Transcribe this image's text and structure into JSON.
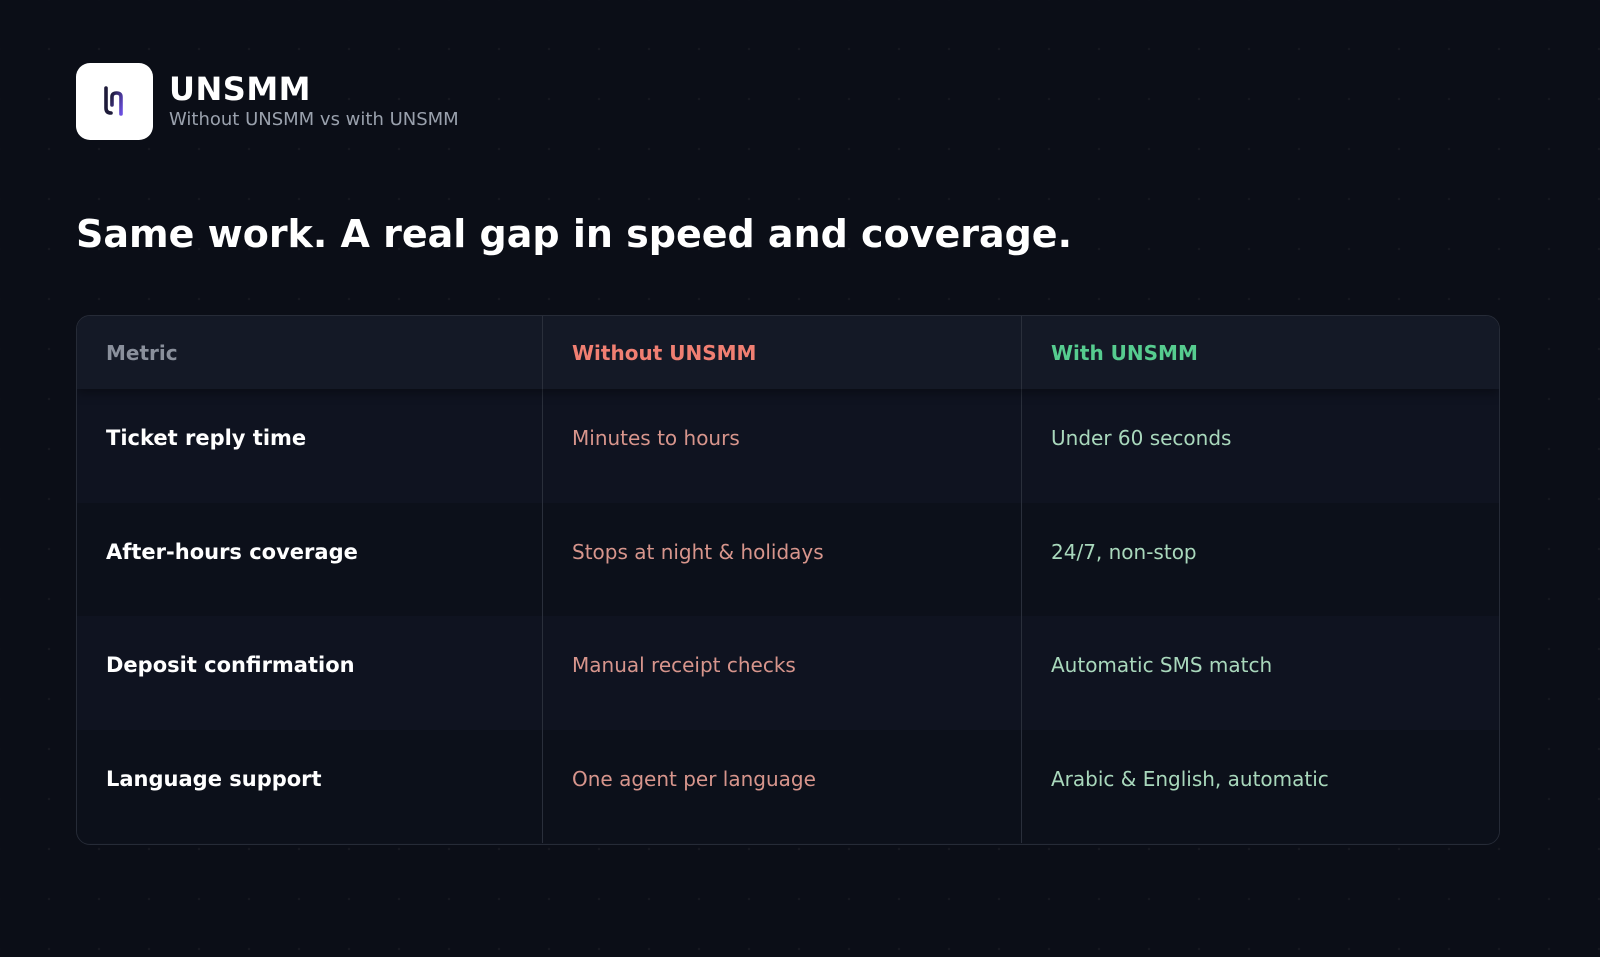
{
  "brand": {
    "name": "UNSMM",
    "subtitle": "Without UNSMM vs with UNSMM",
    "logo_icon": "unsmm-logo-icon",
    "logo_accent_color": "#6b4fe0"
  },
  "headline": "Same work. A real gap in speed and coverage.",
  "table": {
    "headers": {
      "metric": "Metric",
      "without": "Without UNSMM",
      "with": "With UNSMM"
    },
    "rows": [
      {
        "metric": "Ticket reply time",
        "without": "Minutes to hours",
        "with": "Under 60 seconds"
      },
      {
        "metric": "After-hours coverage",
        "without": "Stops at night & holidays",
        "with": "24/7, non-stop"
      },
      {
        "metric": "Deposit confirmation",
        "without": "Manual receipt checks",
        "with": "Automatic SMS match"
      },
      {
        "metric": "Language support",
        "without": "One agent per language",
        "with": "Arabic & English, automatic"
      }
    ]
  },
  "colors": {
    "background": "#0b0e17",
    "without_accent": "#f07f72",
    "with_accent": "#56cc8f"
  }
}
